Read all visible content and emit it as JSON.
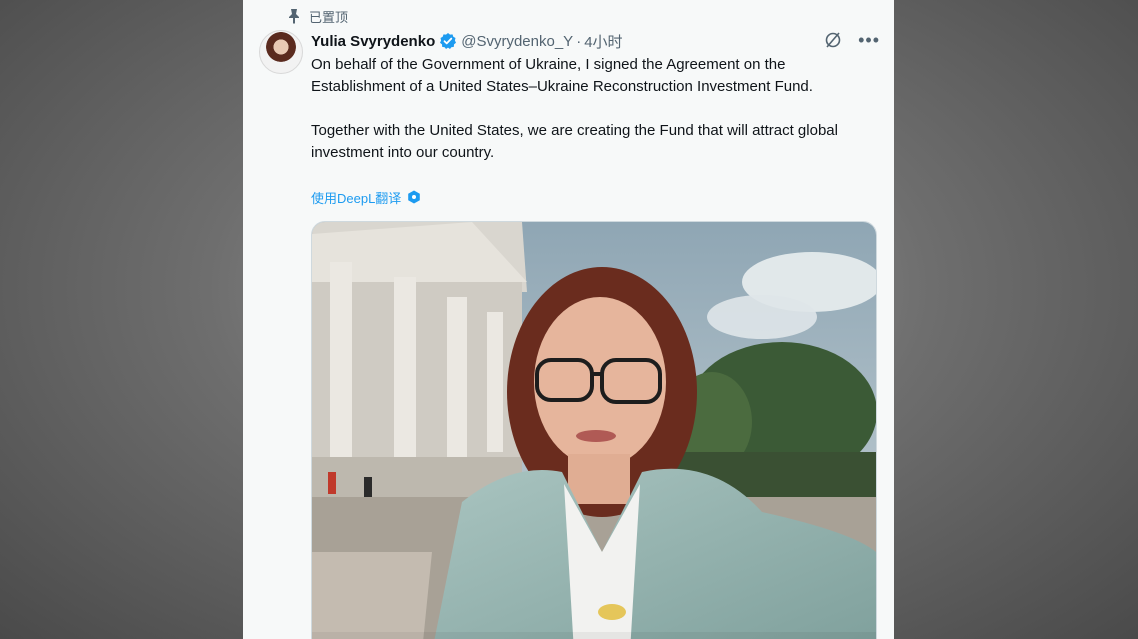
{
  "pinned": {
    "label": "已置顶"
  },
  "author": {
    "display_name": "Yulia Svyrydenko",
    "handle": "@Svyrydenko_Y",
    "separator": "·",
    "time": "4小时"
  },
  "tweet": {
    "paragraph1": "On behalf of the Government of Ukraine, I signed the Agreement on the Establishment of a United States–Ukraine Reconstruction Investment Fund.",
    "paragraph2": "Together with the United States, we are creating the Fund that will attract global investment into our country."
  },
  "translate": {
    "label": "使用DeepL翻译",
    "icon": "deepl-icon"
  },
  "icons": {
    "pin": "pin-icon",
    "verified": "verified-badge-icon",
    "grok": "grok-icon",
    "more": "more-icon"
  },
  "colors": {
    "link": "#1d9bf0",
    "verified": "#1d9bf0",
    "text": "#0f1419",
    "secondary": "#536471",
    "card_bg": "#f7f9f9"
  }
}
